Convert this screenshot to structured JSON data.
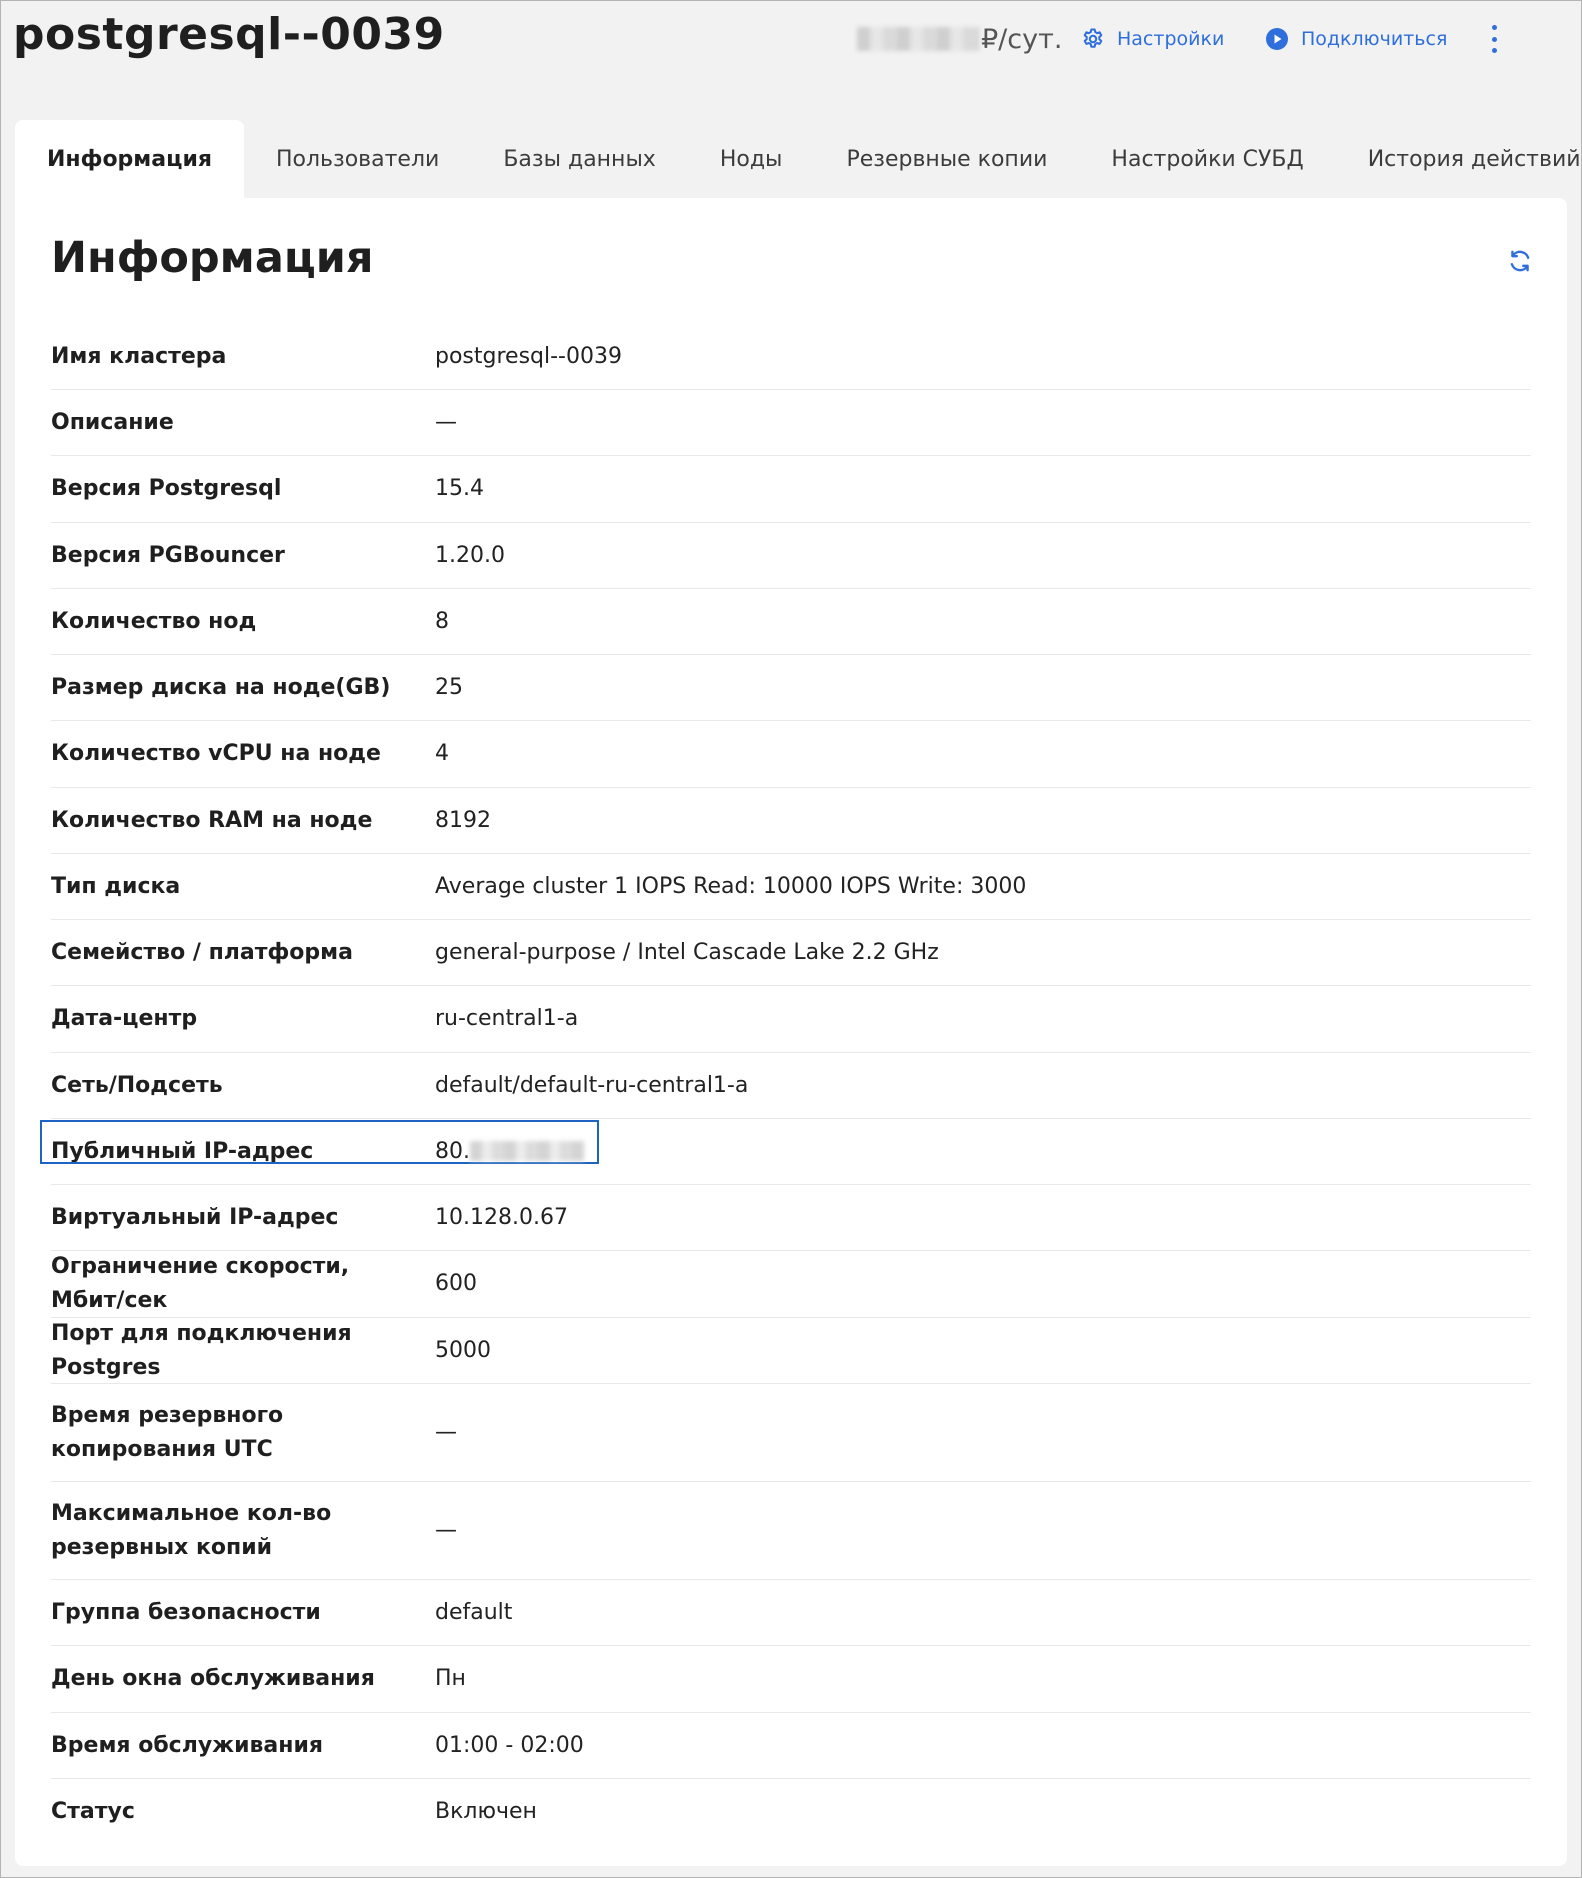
{
  "header": {
    "cluster_name": "postgresql--0039",
    "price_suffix": "₽/сут.",
    "settings_label": "Настройки",
    "connect_label": "Подключиться",
    "accent_color": "#2f6fdc"
  },
  "tabs": [
    {
      "label": "Информация",
      "active": true
    },
    {
      "label": "Пользователи"
    },
    {
      "label": "Базы данных"
    },
    {
      "label": "Ноды"
    },
    {
      "label": "Резервные копии"
    },
    {
      "label": "Настройки СУБД"
    },
    {
      "label": "История действий"
    }
  ],
  "info": {
    "title": "Информация",
    "rows": [
      {
        "label": "Имя кластера",
        "value": "postgresql--0039"
      },
      {
        "label": "Описание",
        "value": "—"
      },
      {
        "label": "Версия Postgresql",
        "value": "15.4"
      },
      {
        "label": "Версия PGBouncer",
        "value": "1.20.0"
      },
      {
        "label": "Количество нод",
        "value": "8"
      },
      {
        "label": "Размер диска на ноде(GB)",
        "value": "25"
      },
      {
        "label": "Количество vCPU на ноде",
        "value": "4"
      },
      {
        "label": "Количество RAM на ноде",
        "value": "8192"
      },
      {
        "label": "Тип диска",
        "value": "Average cluster 1 IOPS Read: 10000 IOPS Write: 3000"
      },
      {
        "label": "Семейство / платформа",
        "value": "general-purpose / Intel Cascade Lake 2.2 GHz"
      },
      {
        "label": "Дата-центр",
        "value": "ru-central1-a"
      },
      {
        "label": "Сеть/Подсеть",
        "value": "default/default-ru-central1-a"
      },
      {
        "label": "Публичный IP-адрес",
        "value": "80."
      },
      {
        "label": "Виртуальный IP-адрес",
        "value": "10.128.0.67"
      },
      {
        "label": "Ограничение скорости, Мбит/сек",
        "value": "600"
      },
      {
        "label": "Порт для подключения Postgres",
        "value": "5000"
      },
      {
        "label": "Время резервного копирования UTC",
        "value": "—"
      },
      {
        "label": "Максимальное кол-во резервных копий",
        "value": "—"
      },
      {
        "label": "Группа безопасности",
        "value": "default"
      },
      {
        "label": "День окна обслуживания",
        "value": "Пн"
      },
      {
        "label": "Время обслуживания",
        "value": "01:00 - 02:00"
      },
      {
        "label": "Статус",
        "value": "Включен"
      }
    ]
  }
}
